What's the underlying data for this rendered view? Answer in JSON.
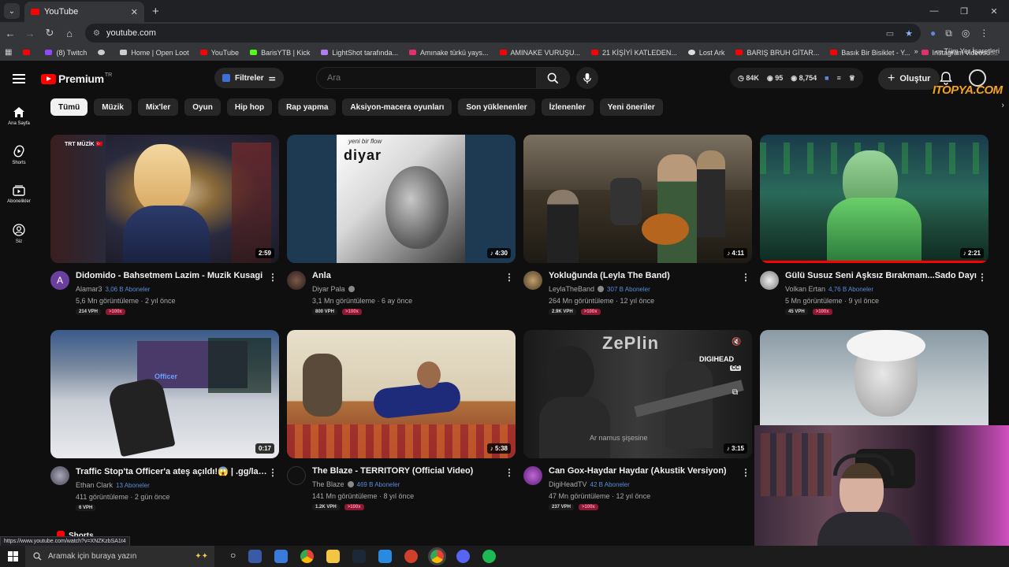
{
  "browser": {
    "tab_title": "YouTube",
    "url": "youtube.com",
    "bookmarks": [
      {
        "label": "(8) Twitch",
        "color": "#9146ff"
      },
      {
        "label": "Home | Open Loot",
        "color": "#cccccc"
      },
      {
        "label": "YouTube",
        "color": "#ff0000"
      },
      {
        "label": "BarisYTB | Kick",
        "color": "#53fc18"
      },
      {
        "label": "LightShot tarafında...",
        "color": "#b07cf0"
      },
      {
        "label": "Amınake türkü yays...",
        "color": "#e1306c"
      },
      {
        "label": "AMINAKE VURUŞU...",
        "color": "#ff0000"
      },
      {
        "label": "21 KİŞİYİ KATLEDEN...",
        "color": "#ff0000"
      },
      {
        "label": "Lost Ark",
        "color": "#dddddd"
      },
      {
        "label": "BARIŞ BRUH GİTAR...",
        "color": "#ff0000"
      },
      {
        "label": "Basık Bir Bisiklet - Y...",
        "color": "#ff0000"
      },
      {
        "label": "Instagram videosu:...",
        "color": "#e1306c"
      }
    ],
    "all_bookmarks": "Tüm Yer İşaretleri",
    "status_url": "https://www.youtube.com/watch?v=XNZKzbSA1t4"
  },
  "header": {
    "logo_text": "Premium",
    "logo_region": "TR",
    "filters_label": "Filtreler",
    "search_placeholder": "Ara",
    "stats": [
      "84K",
      "95",
      "8,754"
    ],
    "create_label": "Oluştur",
    "watermark": "ITOPYA.COM"
  },
  "sidebar": {
    "items": [
      {
        "label": "Ana Sayfa"
      },
      {
        "label": "Shorts"
      },
      {
        "label": "Abonelikler"
      },
      {
        "label": "Siz"
      }
    ]
  },
  "chips": [
    "Tümü",
    "Müzik",
    "Mix'ler",
    "Oyun",
    "Hip hop",
    "Rap yapma",
    "Aksiyon-macera oyunları",
    "Son yüklenenler",
    "İzlenenler",
    "Yeni öneriler"
  ],
  "videos": [
    {
      "title": "Didomido - Bahsetmem Lazim - Muzik Kusagi",
      "channel": "Alamar3",
      "subs": "3,06 B Aboneler",
      "views": "5,6 Mn görüntüleme · 2 yıl önce",
      "vph": "214 VPH",
      "rate": ">100x",
      "duration": "2:59",
      "avatar_letter": "A"
    },
    {
      "title": "Anla",
      "channel": "Diyar Pala",
      "subs": "",
      "views": "3,1 Mn görüntüleme · 6 ay önce",
      "vph": "800 VPH",
      "rate": ">100x",
      "duration": "4:30",
      "thumb_text": "yeni bir flow",
      "thumb_logo": "diyar"
    },
    {
      "title": "Yokluğunda (Leyla The Band)",
      "channel": "LeylaTheBand",
      "subs": "307 B Aboneler",
      "views": "264 Mn görüntüleme · 12 yıl önce",
      "vph": "2.9K VPH",
      "rate": ">100x",
      "duration": "4:11"
    },
    {
      "title": "Gülü Susuz Seni Aşksız Bırakmam...Sado Dayı",
      "channel": "Volkan Ertan",
      "subs": "4,76 B Aboneler",
      "views": "5 Mn görüntüleme · 9 yıl önce",
      "vph": "45 VPH",
      "rate": ">100x",
      "duration": "2:21"
    },
    {
      "title": "Traffic Stop'ta Officer'a ateş açıldı!😱 | .gg/lapdhq",
      "channel": "Ethan Clark",
      "subs": "13 Aboneler",
      "views": "411 görüntüleme · 2 gün önce",
      "vph": "6 VPH",
      "rate": "",
      "duration": "0:17",
      "thumb_text": "Officer"
    },
    {
      "title": "The Blaze - TERRITORY (Official Video)",
      "channel": "The Blaze",
      "subs": "469 B Aboneler",
      "views": "141 Mn görüntüleme · 8 yıl önce",
      "vph": "1.2K VPH",
      "rate": ">100x",
      "duration": "5:38"
    },
    {
      "title": "Can Gox-Haydar Haydar (Akustik Versiyon)",
      "channel": "DigiHeadTV",
      "subs": "42 B Aboneler",
      "views": "47 Mn görüntüleme · 12 yıl önce",
      "vph": "237 VPH",
      "rate": ">100x",
      "duration": "3:15",
      "thumb_text": "ZePlin",
      "thumb_logo": "DIGIHEAD",
      "thumb_caption": "Ar namus şişesine",
      "thumb_cc": "CC"
    }
  ],
  "shorts_heading": "Shorts",
  "taskbar": {
    "search_placeholder": "Aramak için buraya yazın"
  },
  "colors": {
    "accent_red": "#ff0000",
    "subs_blue": "#5b8bd8",
    "rate_badge": "#8a1a33"
  }
}
